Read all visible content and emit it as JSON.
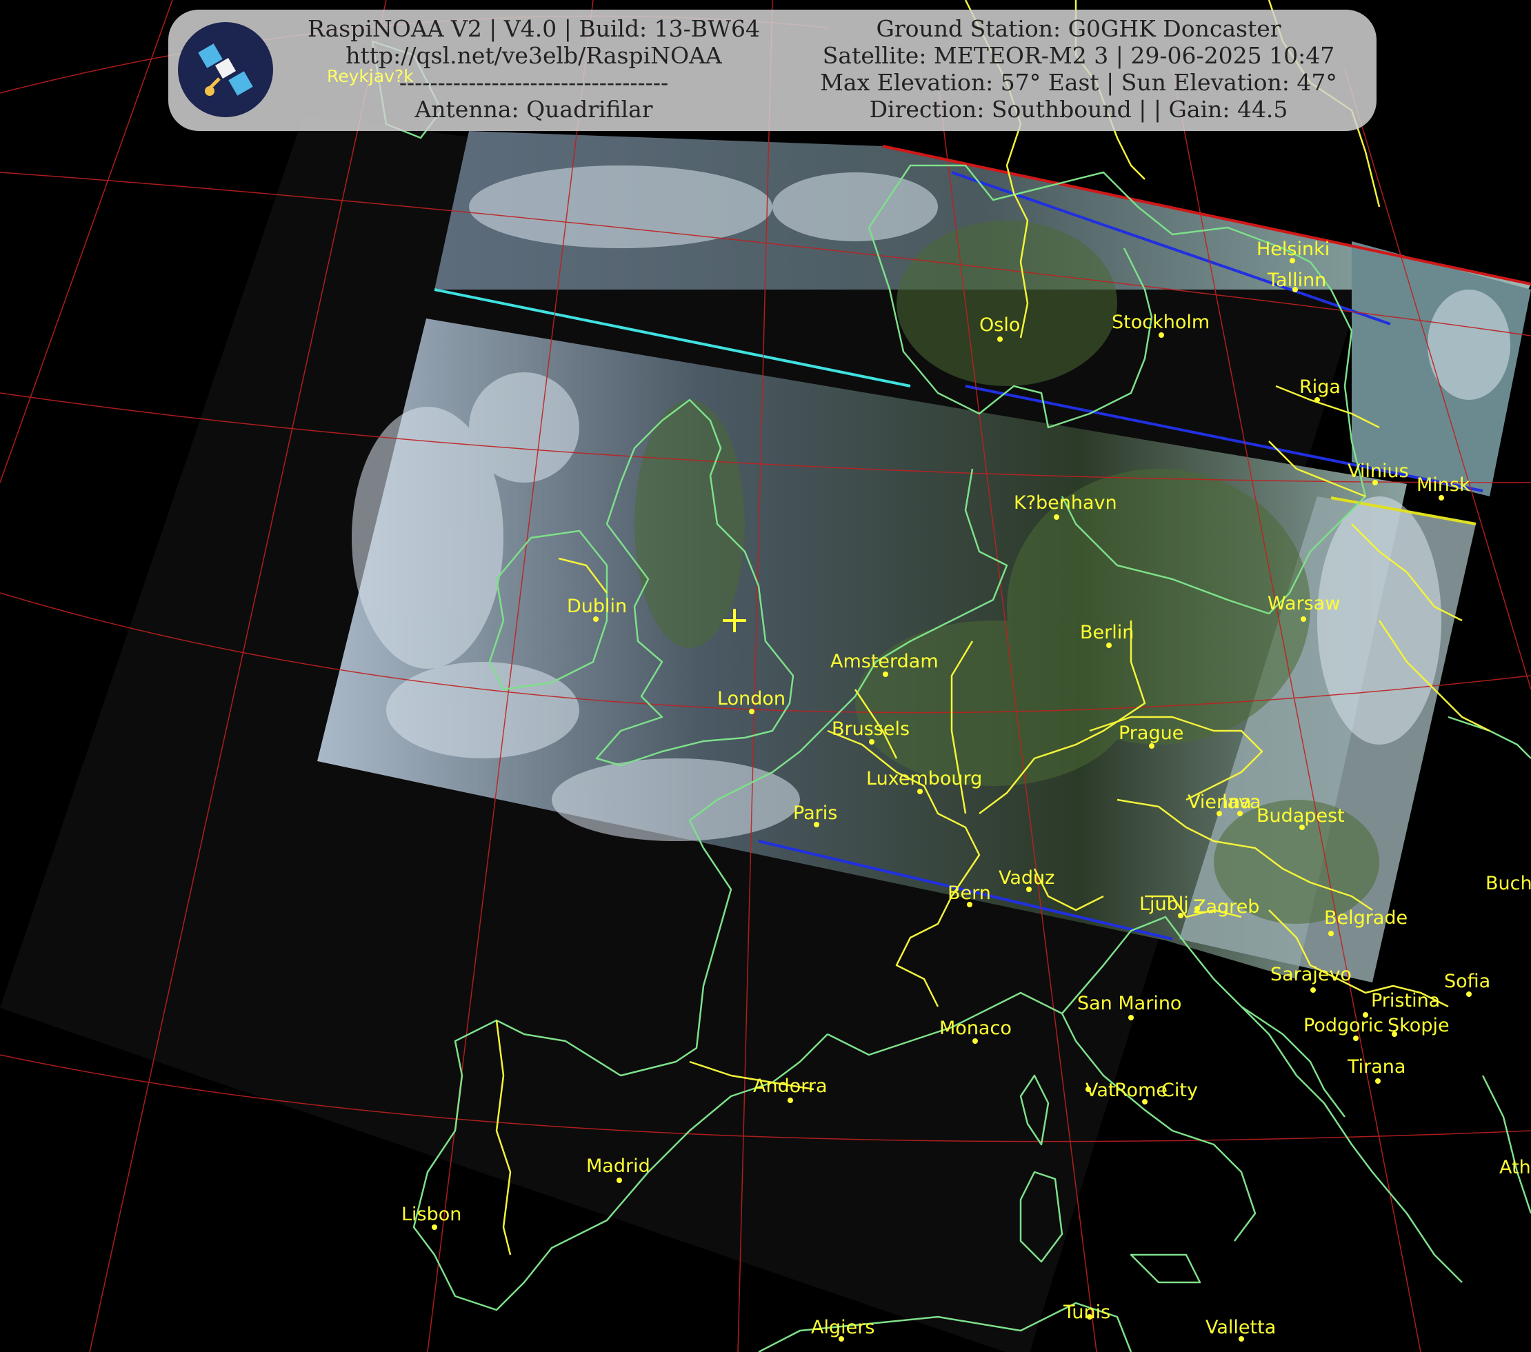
{
  "header": {
    "line1_left": "RaspiNOAA V2 | V4.0 | Build: 13-BW64",
    "line2_left": "http://qsl.net/ve3elb/RaspiNOAA",
    "line3_left": "-----------------------------------",
    "line4_left": "Antenna: Quadrifilar",
    "line1_right": "Ground Station: G0GHK Doncaster",
    "line2_right": "Satellite: METEOR-M2 3 | 29-06-2025 10:47",
    "line3_right": "Max Elevation: 57° East | Sun Elevation: 47°",
    "line4_right": "Direction: Southbound | | Gain: 44.5",
    "logo_icon": "satellite-icon"
  },
  "map": {
    "colors": {
      "background": "#000000",
      "coastline": "#7ee08a",
      "border": "#f4f43a",
      "graticule": "#c02020",
      "label": "#ffff33",
      "marker": "#ffff33"
    },
    "cities": {
      "reykjavik": "Reykjav?k",
      "helsinki": "Helsinki",
      "tallinn": "Tallinn",
      "oslo": "Oslo",
      "stockholm": "Stockholm",
      "riga": "Riga",
      "vilnius": "Vilnius",
      "minsk": "Minsk",
      "kobenhavn": "K?benhavn",
      "dublin": "Dublin",
      "warsaw": "Warsaw",
      "berlin": "Berlin",
      "amsterdam": "Amsterdam",
      "london": "London",
      "brussels": "Brussels",
      "prague": "Prague",
      "luxembourg": "Luxembourg",
      "vienna": "Vienna",
      "bratislava": "lava",
      "budapest": "Budapest",
      "paris": "Paris",
      "vaduz": "Vaduz",
      "bern": "Bern",
      "ljubljana": "Ljublj",
      "zagreb": "Zagreb",
      "belgrade": "Belgrade",
      "bucharest": "Buch",
      "sarajevo": "Sarajevo",
      "sofia": "Sofia",
      "san_marino": "San Marino",
      "pristina": "Pristina",
      "monaco": "Monaco",
      "podgorica": "Podgoric",
      "skopje": "Skopje",
      "tirana": "Tirana",
      "andorra": "Andorra",
      "vatican": "Vat",
      "rome": "Rome",
      "city": "City",
      "madrid": "Madrid",
      "athens": "Ath",
      "lisbon": "Lisbon",
      "tunis": "Tunis",
      "algiers": "Algiers",
      "valletta": "Valletta"
    }
  }
}
